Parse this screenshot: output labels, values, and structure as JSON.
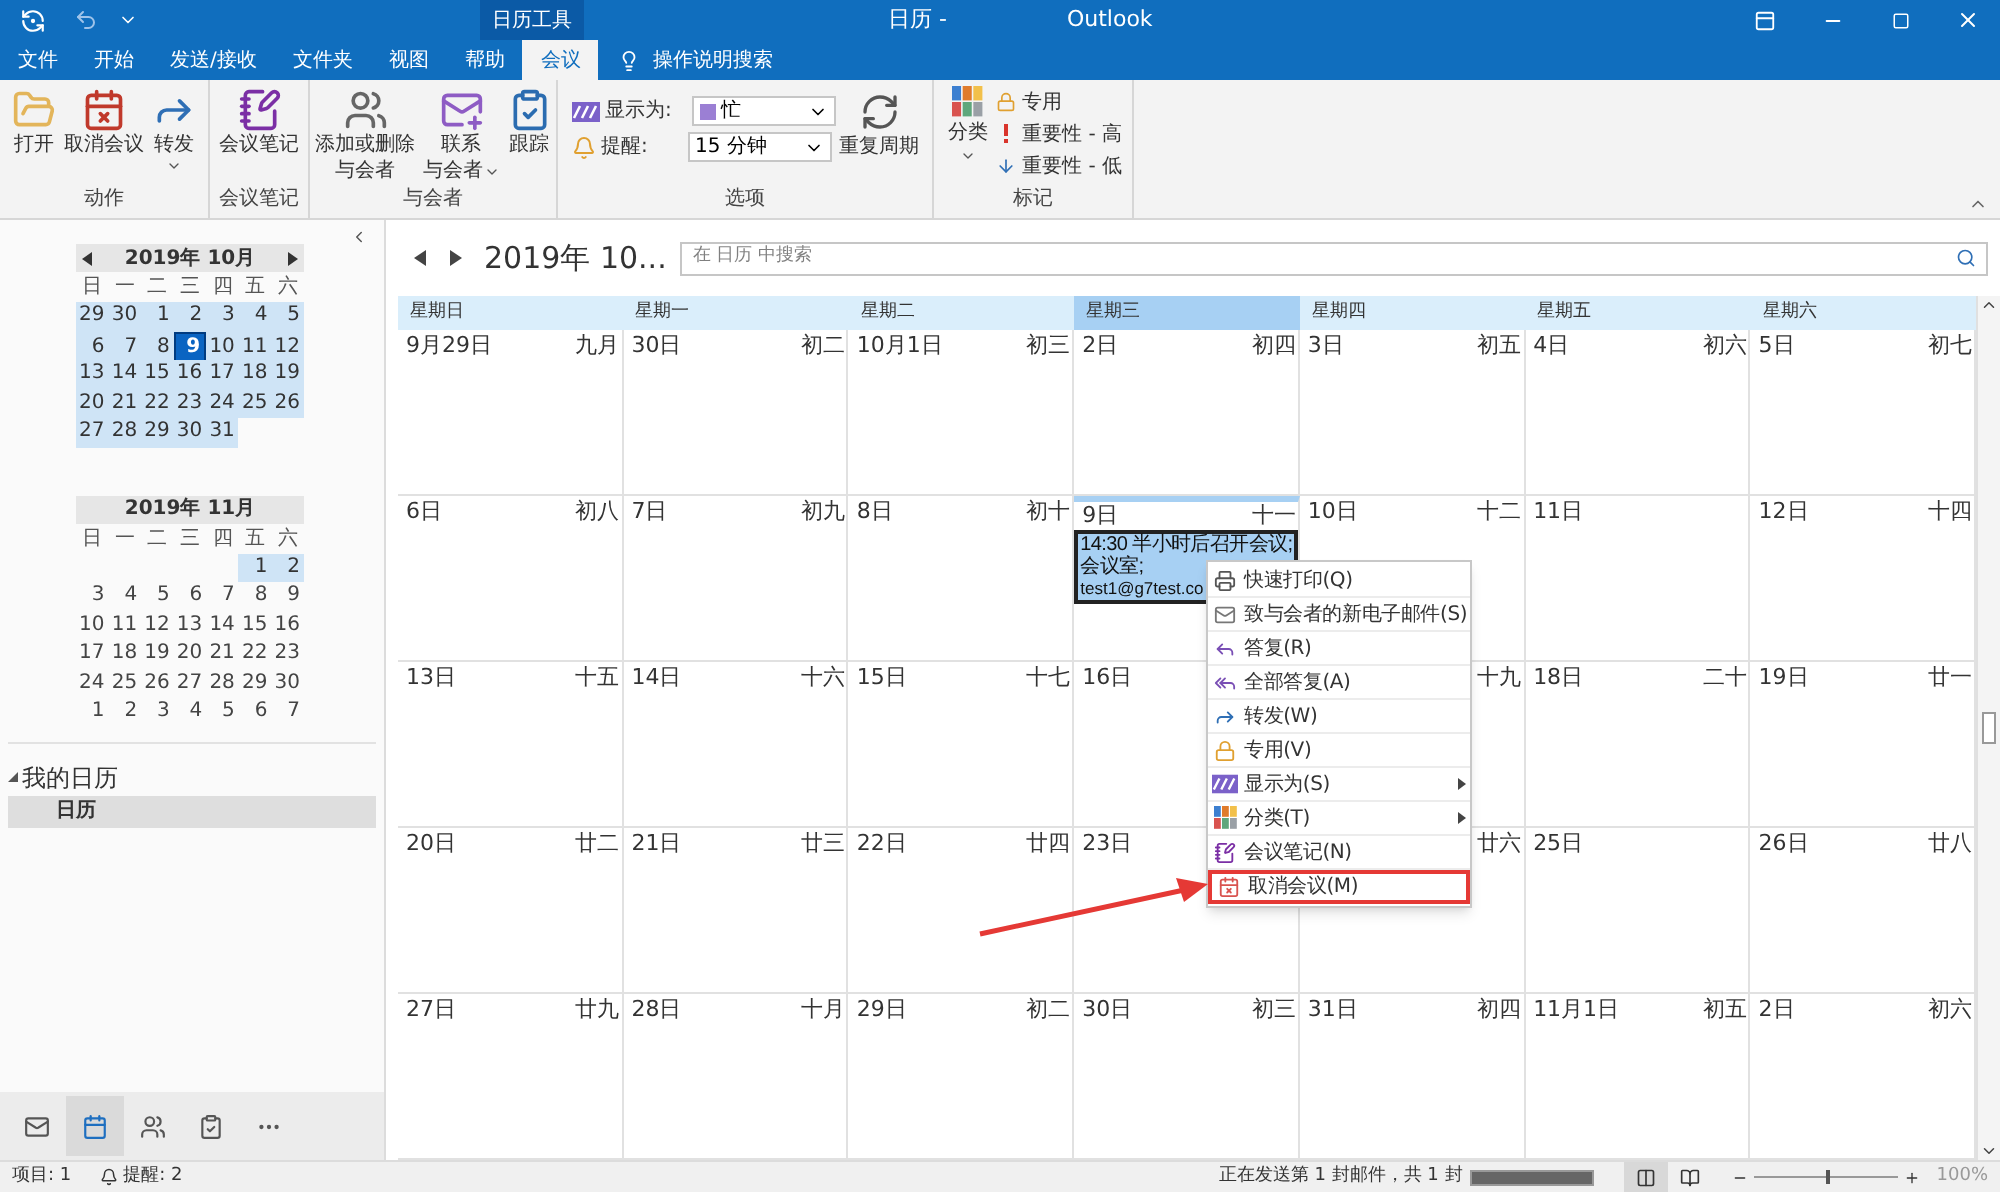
{
  "title_bar": {
    "context_tab": "日历工具",
    "title": "日历 -",
    "app": "Outlook"
  },
  "tabs": [
    {
      "label": "文件",
      "selected": false
    },
    {
      "label": "开始",
      "selected": false
    },
    {
      "label": "发送/接收",
      "selected": false
    },
    {
      "label": "文件夹",
      "selected": false
    },
    {
      "label": "视图",
      "selected": false
    },
    {
      "label": "帮助",
      "selected": false
    },
    {
      "label": "会议",
      "selected": true
    }
  ],
  "tell_me": "操作说明搜索",
  "ribbon": {
    "actions": {
      "label": "动作",
      "buttons": [
        {
          "lines": [
            "打开"
          ],
          "dropdown": false
        },
        {
          "lines": [
            "取消会议"
          ],
          "dropdown": false
        },
        {
          "lines": [
            "转发"
          ],
          "dropdown": true
        }
      ]
    },
    "notes": {
      "label": "会议笔记",
      "buttons": [
        {
          "lines": [
            "会议笔记"
          ],
          "dropdown": false
        }
      ]
    },
    "attendees": {
      "label": "与会者",
      "buttons": [
        {
          "lines": [
            "添加或删除",
            "与会者"
          ],
          "dropdown": false
        },
        {
          "lines": [
            "联系",
            "与会者"
          ],
          "dropdown": true
        },
        {
          "lines": [
            "跟踪"
          ],
          "dropdown": false
        }
      ]
    },
    "options": {
      "label": "选项",
      "show_as": {
        "label": "显示为:",
        "value": "忙"
      },
      "reminder": {
        "label": "提醒:",
        "value": "15 分钟"
      },
      "recurrence": "重复周期"
    },
    "tags": {
      "label": "标记",
      "categorize": {
        "label": "分类",
        "dropdown": true
      },
      "items": [
        "专用",
        "重要性 - 高",
        "重要性 - 低"
      ]
    }
  },
  "mini_calendars": [
    {
      "title": "2019年 10月",
      "nav": true,
      "weekdays": [
        "日",
        "一",
        "二",
        "三",
        "四",
        "五",
        "六"
      ],
      "weeks": [
        [
          {
            "kind": "day",
            "day": "29",
            "in_view": true,
            "selected": false
          },
          {
            "kind": "day",
            "day": "30",
            "in_view": true,
            "selected": false
          },
          {
            "kind": "day",
            "day": "1",
            "in_view": true,
            "selected": false
          },
          {
            "kind": "day",
            "day": "2",
            "in_view": true,
            "selected": false
          },
          {
            "kind": "day",
            "day": "3",
            "in_view": true,
            "selected": false
          },
          {
            "kind": "day",
            "day": "4",
            "in_view": true,
            "selected": false
          },
          {
            "kind": "day",
            "day": "5",
            "in_view": true,
            "selected": false
          }
        ],
        [
          {
            "kind": "day",
            "day": "6",
            "in_view": true,
            "selected": false
          },
          {
            "kind": "day",
            "day": "7",
            "in_view": true,
            "selected": false
          },
          {
            "kind": "day",
            "day": "8",
            "in_view": true,
            "selected": false
          },
          {
            "kind": "day",
            "day": "9",
            "in_view": true,
            "selected": true
          },
          {
            "kind": "day",
            "day": "10",
            "in_view": true,
            "selected": false
          },
          {
            "kind": "day",
            "day": "11",
            "in_view": true,
            "selected": false
          },
          {
            "kind": "day",
            "day": "12",
            "in_view": true,
            "selected": false
          }
        ],
        [
          {
            "kind": "day",
            "day": "13",
            "in_view": true,
            "selected": false
          },
          {
            "kind": "day",
            "day": "14",
            "in_view": true,
            "selected": false
          },
          {
            "kind": "day",
            "day": "15",
            "in_view": true,
            "selected": false
          },
          {
            "kind": "day",
            "day": "16",
            "in_view": true,
            "selected": false
          },
          {
            "kind": "day",
            "day": "17",
            "in_view": true,
            "selected": false
          },
          {
            "kind": "day",
            "day": "18",
            "in_view": true,
            "selected": false
          },
          {
            "kind": "day",
            "day": "19",
            "in_view": true,
            "selected": false
          }
        ],
        [
          {
            "kind": "day",
            "day": "20",
            "in_view": true,
            "selected": false
          },
          {
            "kind": "day",
            "day": "21",
            "in_view": true,
            "selected": false
          },
          {
            "kind": "day",
            "day": "22",
            "in_view": true,
            "selected": false
          },
          {
            "kind": "day",
            "day": "23",
            "in_view": true,
            "selected": false
          },
          {
            "kind": "day",
            "day": "24",
            "in_view": true,
            "selected": false
          },
          {
            "kind": "day",
            "day": "25",
            "in_view": true,
            "selected": false
          },
          {
            "kind": "day",
            "day": "26",
            "in_view": true,
            "selected": false
          }
        ],
        [
          {
            "kind": "day",
            "day": "27",
            "in_view": true,
            "selected": false
          },
          {
            "kind": "day",
            "day": "28",
            "in_view": true,
            "selected": false
          },
          {
            "kind": "day",
            "day": "29",
            "in_view": true,
            "selected": false
          },
          {
            "kind": "day",
            "day": "30",
            "in_view": true,
            "selected": false
          },
          {
            "kind": "day",
            "day": "31",
            "in_view": true,
            "selected": false
          },
          {
            "kind": "blank"
          },
          {
            "kind": "blank"
          }
        ]
      ]
    },
    {
      "title": "2019年 11月",
      "nav": false,
      "weekdays": [
        "日",
        "一",
        "二",
        "三",
        "四",
        "五",
        "六"
      ],
      "weeks": [
        [
          {
            "kind": "blank"
          },
          {
            "kind": "blank"
          },
          {
            "kind": "blank"
          },
          {
            "kind": "blank"
          },
          {
            "kind": "blank"
          },
          {
            "kind": "day",
            "day": "1",
            "in_view": true,
            "selected": false
          },
          {
            "kind": "day",
            "day": "2",
            "in_view": true,
            "selected": false
          }
        ],
        [
          {
            "kind": "day",
            "day": "3",
            "in_view": false,
            "selected": false
          },
          {
            "kind": "day",
            "day": "4",
            "in_view": false,
            "selected": false
          },
          {
            "kind": "day",
            "day": "5",
            "in_view": false,
            "selected": false
          },
          {
            "kind": "day",
            "day": "6",
            "in_view": false,
            "selected": false
          },
          {
            "kind": "day",
            "day": "7",
            "in_view": false,
            "selected": false
          },
          {
            "kind": "day",
            "day": "8",
            "in_view": false,
            "selected": false
          },
          {
            "kind": "day",
            "day": "9",
            "in_view": false,
            "selected": false
          }
        ],
        [
          {
            "kind": "day",
            "day": "10",
            "in_view": false,
            "selected": false
          },
          {
            "kind": "day",
            "day": "11",
            "in_view": false,
            "selected": false
          },
          {
            "kind": "day",
            "day": "12",
            "in_view": false,
            "selected": false
          },
          {
            "kind": "day",
            "day": "13",
            "in_view": false,
            "selected": false
          },
          {
            "kind": "day",
            "day": "14",
            "in_view": false,
            "selected": false
          },
          {
            "kind": "day",
            "day": "15",
            "in_view": false,
            "selected": false
          },
          {
            "kind": "day",
            "day": "16",
            "in_view": false,
            "selected": false
          }
        ],
        [
          {
            "kind": "day",
            "day": "17",
            "in_view": false,
            "selected": false
          },
          {
            "kind": "day",
            "day": "18",
            "in_view": false,
            "selected": false
          },
          {
            "kind": "day",
            "day": "19",
            "in_view": false,
            "selected": false
          },
          {
            "kind": "day",
            "day": "20",
            "in_view": false,
            "selected": false
          },
          {
            "kind": "day",
            "day": "21",
            "in_view": false,
            "selected": false
          },
          {
            "kind": "day",
            "day": "22",
            "in_view": false,
            "selected": false
          },
          {
            "kind": "day",
            "day": "23",
            "in_view": false,
            "selected": false
          }
        ],
        [
          {
            "kind": "day",
            "day": "24",
            "in_view": false,
            "selected": false
          },
          {
            "kind": "day",
            "day": "25",
            "in_view": false,
            "selected": false
          },
          {
            "kind": "day",
            "day": "26",
            "in_view": false,
            "selected": false
          },
          {
            "kind": "day",
            "day": "27",
            "in_view": false,
            "selected": false
          },
          {
            "kind": "day",
            "day": "28",
            "in_view": false,
            "selected": false
          },
          {
            "kind": "day",
            "day": "29",
            "in_view": false,
            "selected": false
          },
          {
            "kind": "day",
            "day": "30",
            "in_view": false,
            "selected": false
          }
        ],
        [
          {
            "kind": "day",
            "day": "1",
            "in_view": false,
            "selected": false
          },
          {
            "kind": "day",
            "day": "2",
            "in_view": false,
            "selected": false
          },
          {
            "kind": "day",
            "day": "3",
            "in_view": false,
            "selected": false
          },
          {
            "kind": "day",
            "day": "4",
            "in_view": false,
            "selected": false
          },
          {
            "kind": "day",
            "day": "5",
            "in_view": false,
            "selected": false
          },
          {
            "kind": "day",
            "day": "6",
            "in_view": false,
            "selected": false
          },
          {
            "kind": "day",
            "day": "7",
            "in_view": false,
            "selected": false
          }
        ]
      ]
    }
  ],
  "my_calendars": {
    "label": "我的日历",
    "expanded": true,
    "items": [
      {
        "label": "日历",
        "selected": true
      }
    ]
  },
  "nav_bar": [
    {
      "selected": false
    },
    {
      "selected": true
    },
    {
      "selected": false
    },
    {
      "selected": false
    },
    {
      "selected": false
    }
  ],
  "calendar": {
    "title": "2019年 10...",
    "search_placeholder": "在 日历 中搜索",
    "weekdays": [
      {
        "label": "星期日",
        "selected": false
      },
      {
        "label": "星期一",
        "selected": false
      },
      {
        "label": "星期二",
        "selected": false
      },
      {
        "label": "星期三",
        "selected": true
      },
      {
        "label": "星期四",
        "selected": false
      },
      {
        "label": "星期五",
        "selected": false
      },
      {
        "label": "星期六",
        "selected": false
      }
    ],
    "weeks": [
      [
        {
          "date": "9月29日",
          "lunar": "九月",
          "today": false
        },
        {
          "date": "30日",
          "lunar": "初二",
          "today": false
        },
        {
          "date": "10月1日",
          "lunar": "初三",
          "today": false
        },
        {
          "date": "2日",
          "lunar": "初四",
          "today": false
        },
        {
          "date": "3日",
          "lunar": "初五",
          "today": false
        },
        {
          "date": "4日",
          "lunar": "初六",
          "today": false
        },
        {
          "date": "5日",
          "lunar": "初七",
          "today": false
        }
      ],
      [
        {
          "date": "6日",
          "lunar": "初八",
          "today": false
        },
        {
          "date": "7日",
          "lunar": "初九",
          "today": false
        },
        {
          "date": "8日",
          "lunar": "初十",
          "today": false
        },
        {
          "date": "9日",
          "lunar": "十一",
          "today": true,
          "events": [
            {
              "lines": [
                "14:30 半小时后召开会议;",
                "会议室;",
                "test1@g7test.co"
              ]
            }
          ]
        },
        {
          "date": "10日",
          "lunar": "十二",
          "today": false
        },
        {
          "date": "11日",
          "today": false
        },
        {
          "date": "12日",
          "lunar": "十四",
          "today": false
        }
      ],
      [
        {
          "date": "13日",
          "lunar": "十五",
          "today": false
        },
        {
          "date": "14日",
          "lunar": "十六",
          "today": false
        },
        {
          "date": "15日",
          "lunar": "十七",
          "today": false
        },
        {
          "date": "16日",
          "today": false
        },
        {
          "lunar": "十九",
          "today": false
        },
        {
          "date": "18日",
          "lunar": "二十",
          "today": false
        },
        {
          "date": "19日",
          "lunar": "廿一",
          "today": false
        }
      ],
      [
        {
          "date": "20日",
          "lunar": "廿二",
          "today": false
        },
        {
          "date": "21日",
          "lunar": "廿三",
          "today": false
        },
        {
          "date": "22日",
          "lunar": "廿四",
          "today": false
        },
        {
          "date": "23日",
          "today": false
        },
        {
          "lunar": "廿六",
          "today": false
        },
        {
          "date": "25日",
          "today": false
        },
        {
          "date": "26日",
          "lunar": "廿八",
          "today": false
        }
      ],
      [
        {
          "date": "27日",
          "lunar": "廿九",
          "today": false
        },
        {
          "date": "28日",
          "lunar": "十月",
          "today": false
        },
        {
          "date": "29日",
          "lunar": "初二",
          "today": false
        },
        {
          "date": "30日",
          "lunar": "初三",
          "today": false
        },
        {
          "date": "31日",
          "lunar": "初四",
          "today": false
        },
        {
          "date": "11月1日",
          "lunar": "初五",
          "today": false
        },
        {
          "date": "2日",
          "lunar": "初六",
          "today": false
        }
      ]
    ]
  },
  "context_menu": [
    {
      "label": "快速打印(Q)",
      "submenu": false,
      "highlighted": false
    },
    {
      "label": "致与会者的新电子邮件(S)",
      "submenu": false,
      "highlighted": false
    },
    {
      "label": "答复(R)",
      "submenu": false,
      "highlighted": false
    },
    {
      "label": "全部答复(A)",
      "submenu": false,
      "highlighted": false
    },
    {
      "label": "转发(W)",
      "submenu": false,
      "highlighted": false
    },
    {
      "label": "专用(V)",
      "submenu": false,
      "highlighted": false
    },
    {
      "label": "显示为(S)",
      "submenu": true,
      "highlighted": false
    },
    {
      "label": "分类(T)",
      "submenu": true,
      "highlighted": false
    },
    {
      "label": "会议笔记(N)",
      "submenu": false,
      "highlighted": false
    },
    {
      "label": "取消会议(M)",
      "submenu": false,
      "highlighted": true
    }
  ],
  "status_bar": {
    "items": "项目: 1",
    "reminders": "提醒: 2",
    "sending": "正在发送第 1 封邮件，共 1 封",
    "progress": {
      "level": 1
    },
    "zoom": {
      "level": 0.5,
      "reading": "100%"
    }
  }
}
